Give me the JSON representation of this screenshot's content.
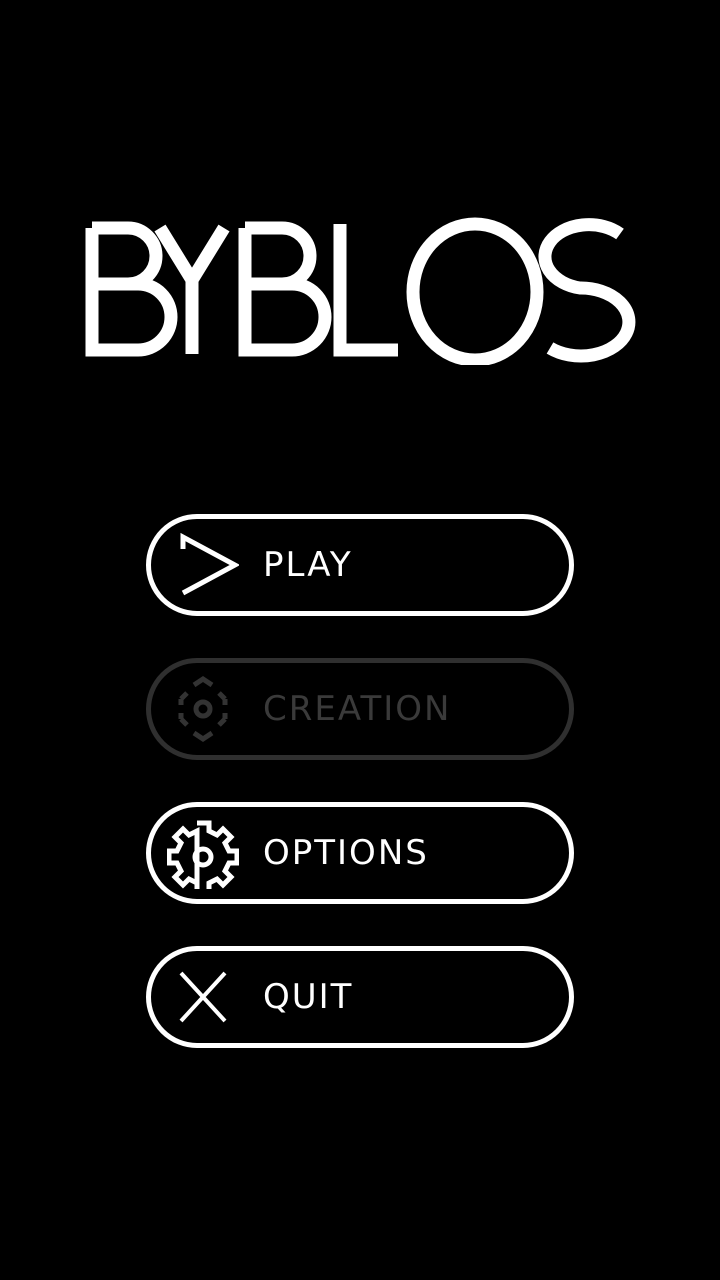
{
  "title": "BYBLOS",
  "menu": {
    "play": {
      "label": "PLAY",
      "icon": "play-triangle-icon",
      "enabled": true
    },
    "creation": {
      "label": "CREATION",
      "icon": "camera-focus-icon",
      "enabled": false
    },
    "options": {
      "label": "OPTIONS",
      "icon": "gear-icon",
      "enabled": true
    },
    "quit": {
      "label": "QUIT",
      "icon": "close-x-icon",
      "enabled": true
    }
  },
  "colors": {
    "background": "#000000",
    "foreground": "#ffffff",
    "disabled": "#333333"
  }
}
